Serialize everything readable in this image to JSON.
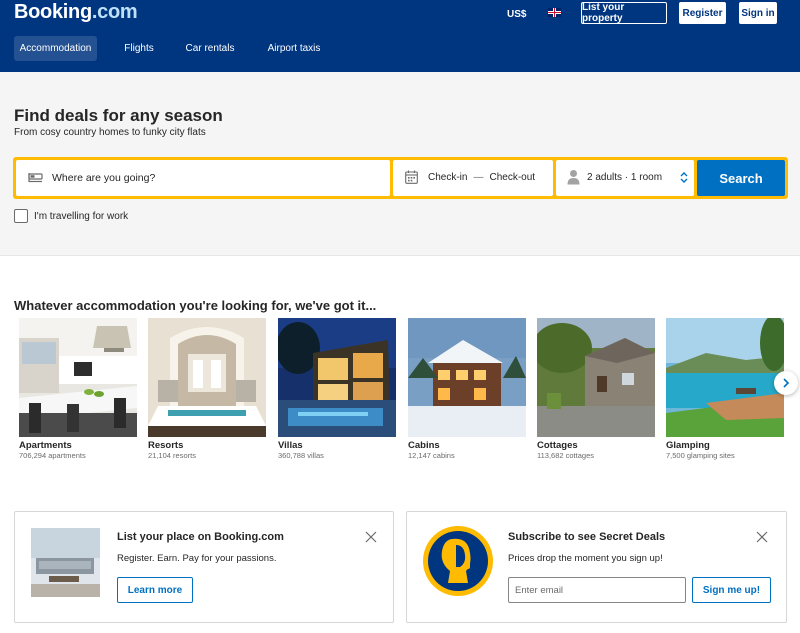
{
  "header": {
    "logo_main": "Booking",
    "logo_suffix": ".com",
    "currency": "US$",
    "language_icon": "uk-flag-icon",
    "list_property_label": "List your property",
    "register_label": "Register",
    "signin_label": "Sign in",
    "nav": [
      {
        "label": "Accommodation",
        "active": true
      },
      {
        "label": "Flights",
        "active": false
      },
      {
        "label": "Car rentals",
        "active": false
      },
      {
        "label": "Airport taxis",
        "active": false
      }
    ]
  },
  "hero": {
    "title": "Find deals for any season",
    "subtitle": "From cosy country homes to funky city flats"
  },
  "search": {
    "destination_placeholder": "Where are you going?",
    "checkin_label": "Check-in",
    "date_separator": "—",
    "checkout_label": "Check-out",
    "guests_label": "2 adults · 1 room",
    "search_label": "Search",
    "work_travel_label": "I'm travelling for work",
    "work_travel_checked": false
  },
  "categories": {
    "title": "Whatever accommodation you're looking for, we've got it...",
    "items": [
      {
        "name": "Apartments",
        "count": "706,294 apartments"
      },
      {
        "name": "Resorts",
        "count": "21,104 resorts"
      },
      {
        "name": "Villas",
        "count": "360,788 villas"
      },
      {
        "name": "Cabins",
        "count": "12,147 cabins"
      },
      {
        "name": "Cottages",
        "count": "113,682 cottages"
      },
      {
        "name": "Glamping",
        "count": "7,500 glamping sites"
      }
    ]
  },
  "promos": {
    "list_place": {
      "title": "List your place on Booking.com",
      "text": "Register. Earn. Pay for your passions.",
      "button": "Learn more"
    },
    "secret_deals": {
      "title": "Subscribe to see Secret Deals",
      "text": "Prices drop the moment you sign up!",
      "email_placeholder": "Enter email",
      "button": "Sign me up!"
    }
  },
  "colors": {
    "brand_blue": "#003580",
    "search_yellow": "#febb02",
    "action_blue": "#0071c2"
  }
}
